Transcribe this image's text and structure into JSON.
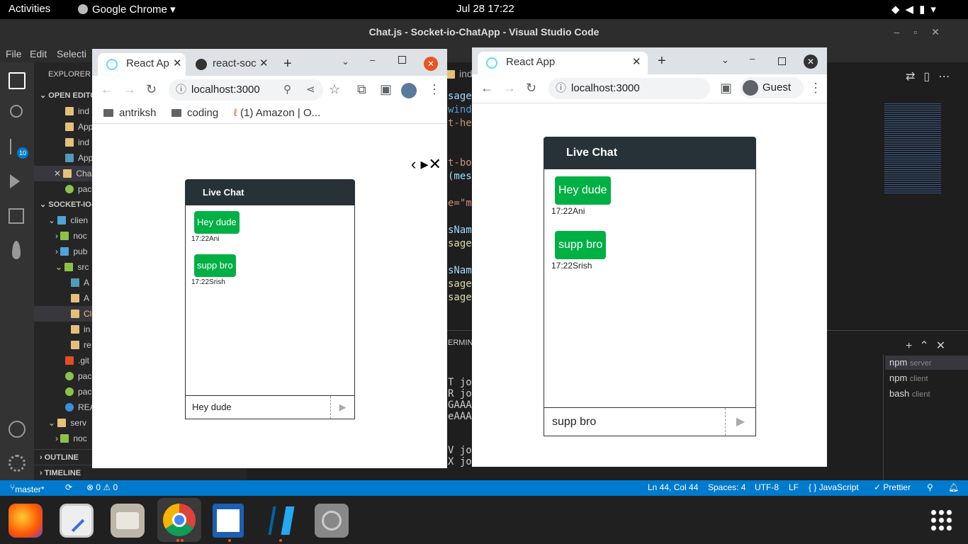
{
  "topbar": {
    "activities": "Activities",
    "app": "Google Chrome",
    "clock": "Jul 28  17:22"
  },
  "vscode": {
    "title": "Chat.js - Socket-io-ChatApp - Visual Studio Code",
    "menu": [
      "File",
      "Edit",
      "Selecti"
    ],
    "explorer": "EXPLORER",
    "open_editors": "OPEN EDITO",
    "project": "SOCKET-IO-",
    "open_files": [
      "ind",
      "App",
      "ind",
      "App",
      "Cha",
      "pac"
    ],
    "tree": [
      "clien",
      "noc",
      "pub",
      "src",
      "A",
      "A",
      "Cl",
      "in",
      "re",
      ".git",
      "pac",
      "pac",
      "REA",
      "serv",
      "noc"
    ],
    "outline": "OUTLINE",
    "timeline": "TIMELINE",
    "scm_badge": "10",
    "editor_tab": "inde",
    "code_lines": [
      "sageLi",
      "windo",
      "t-hea",
      "t-boo",
      "(mess",
      "e=\"me",
      "sName",
      "sage(",
      "sName",
      "sage(",
      "sage("
    ],
    "terminal_label": "ERMIN",
    "terminal_lines": [
      "T jo",
      "R jo",
      "GAAAI",
      "eAAAT",
      "V jo",
      "X jo"
    ],
    "terminals": [
      {
        "cmd": "npm",
        "name": "server"
      },
      {
        "cmd": "npm",
        "name": "client"
      },
      {
        "cmd": "bash",
        "name": "client"
      }
    ]
  },
  "status": {
    "branch": "master*",
    "problems": "⊗ 0 ⚠ 0",
    "position": "Ln 44, Col 44",
    "spaces": "Spaces: 4",
    "encoding": "UTF-8",
    "eol": "LF",
    "language": "{ } JavaScript",
    "prettier": "✓ Prettier"
  },
  "chrome_left": {
    "tab1": "React Ap",
    "tab2": "react-soc",
    "url": "localhost:3000",
    "bookmarks": [
      "antriksh",
      "coding",
      "(1) Amazon | O..."
    ],
    "chat": {
      "title": "Live Chat",
      "messages": [
        {
          "text": "Hey dude",
          "time": "17:22",
          "author": "Ani"
        },
        {
          "text": "supp bro",
          "time": "17:22",
          "author": "Srish"
        }
      ],
      "input": "Hey dude",
      "send": "▶"
    }
  },
  "chrome_right": {
    "tab1": "React App",
    "url": "localhost:3000",
    "profile": "Guest",
    "chat": {
      "title": "Live Chat",
      "messages": [
        {
          "text": "Hey dude",
          "time": "17:22",
          "author": "Ani"
        },
        {
          "text": "supp bro",
          "time": "17:22",
          "author": "Srish"
        }
      ],
      "input": "supp bro",
      "send": "▶"
    }
  },
  "colors": {
    "vscode_blue": "#007acc",
    "chat_header": "#263238",
    "bubble": "#00b044"
  }
}
